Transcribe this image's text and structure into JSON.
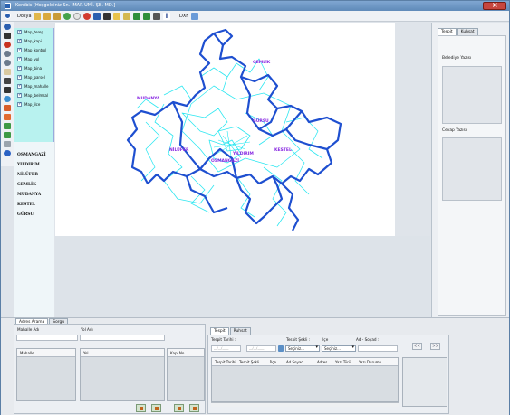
{
  "window": {
    "title": "Kentbis   [Hoşgeldiniz Sn. İMAR UMİ. ŞB. MD.]"
  },
  "toolbar": {
    "menu": "Dosya",
    "dxf": "DXF"
  },
  "layers": [
    "Map_terep",
    "Map_kapi",
    "Map_kontrol",
    "Map_yol",
    "Map_bina",
    "Map_parsel",
    "Map_mahalle",
    "Map_belmsal",
    "Map_ilce"
  ],
  "districts": [
    "OSMANGAZİ",
    "YILDIRIM",
    "NİLÜFER",
    "GEMLİK",
    "MUDANYA",
    "KESTEL",
    "GÜRSU"
  ],
  "map": {
    "labels": [
      "GEMLİK",
      "MUDANYA",
      "GÜRSU",
      "NİLÜFER",
      "KESTEL",
      "YILDIRIM",
      "OSMANGAZİ"
    ],
    "colors": {
      "district_border": "#1e4fd0",
      "streets": "#23e6f0",
      "labels": "#8a2be2"
    }
  },
  "right_panel": {
    "tabs": [
      "Tespit",
      "Kuhsat"
    ],
    "belediye_label": "Belediye Yazısı",
    "cevap_label": "Cevap Yazısı"
  },
  "bottom_left": {
    "tabs": [
      "Adres Arama",
      "Sorgu"
    ],
    "mahalle_adi": "Mahalle Adı",
    "yol_adi": "Yol Adı",
    "columns": [
      "Mahalle",
      "Yol",
      "Kapı No"
    ]
  },
  "bottom_right": {
    "tabs": [
      "Tespit",
      "Ruhsat"
    ],
    "tespit_tarihi": "Tespit Tarihi :",
    "tespit_sekli": "Tespit Şekli :",
    "ilce": "İlçe",
    "ad_soyad": "Ad - Soyad :",
    "date_placeholder": "__/__/____",
    "combo_value": "Seçiniz...",
    "columns": [
      "Tespit Tarihi",
      "Tespit Şekli",
      "İlçe",
      "Ad Soyad",
      "Adres",
      "Yazı Türü",
      "Yazı Durumu"
    ],
    "nav_prev": "<<",
    "nav_next": ">>"
  }
}
